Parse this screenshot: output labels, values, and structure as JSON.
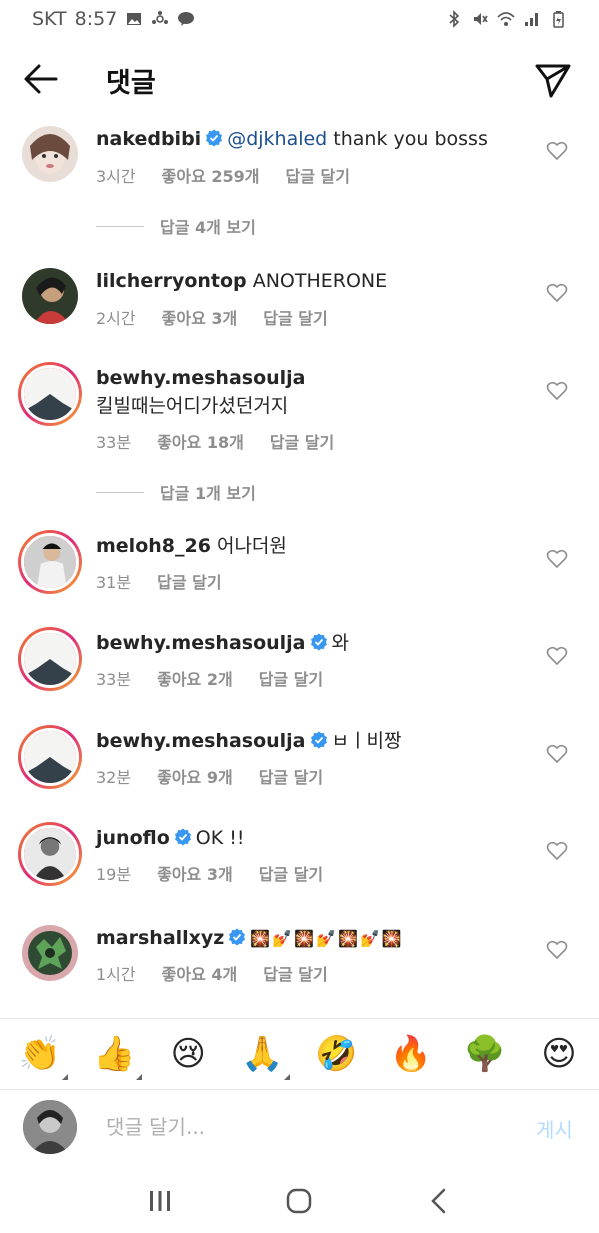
{
  "status": {
    "carrier": "SKT",
    "time": "8:57"
  },
  "header": {
    "title": "댓글"
  },
  "comments": [
    {
      "username": "nakedbibi",
      "verified": true,
      "mention": "@djkhaled",
      "text": " thank you bosss",
      "time": "3시간",
      "likes": "좋아요 259개",
      "reply": "답글 달기"
    },
    {
      "username": "lilcherryontop",
      "verified": false,
      "text": " ANOTHERONE",
      "time": "2시간",
      "likes": "좋아요 3개",
      "reply": "답글 달기"
    },
    {
      "username": "bewhy.meshasoulja",
      "verified": false,
      "text": "킬빌때는어디가셨던거지",
      "time": "33분",
      "likes": "좋아요 18개",
      "reply": "답글 달기"
    },
    {
      "username": "meloh8_26",
      "verified": false,
      "text": " 어나더원",
      "time": "31분",
      "reply": "답글 달기"
    },
    {
      "username": "bewhy.meshasoulja",
      "verified": true,
      "text": "와",
      "time": "33분",
      "likes": "좋아요 2개",
      "reply": "답글 달기"
    },
    {
      "username": "bewhy.meshasoulja",
      "verified": true,
      "text": "ㅂㅣ비짱",
      "time": "32분",
      "likes": "좋아요 9개",
      "reply": "답글 달기"
    },
    {
      "username": "junoflo",
      "verified": true,
      "text": "OK !!",
      "time": "19분",
      "likes": "좋아요 3개",
      "reply": "답글 달기"
    },
    {
      "username": "marshallxyz",
      "verified": true,
      "text": "🎇💅🎇💅🎇💅🎇",
      "time": "1시간",
      "likes": "좋아요 4개",
      "reply": "답글 달기"
    }
  ],
  "view_replies": [
    "답글 4개 보기",
    "답글 1개 보기"
  ],
  "emoji_bar": [
    "👏",
    "👍",
    "😢",
    "🙏",
    "🤣",
    "🔥",
    "🌳",
    "😍"
  ],
  "input": {
    "placeholder": "댓글 달기...",
    "post_label": "게시"
  },
  "colors": {
    "mention": "#1d4f91",
    "verified": "#3897f0",
    "post_disabled": "#b3dbff",
    "meta": "#8e8e8e"
  }
}
